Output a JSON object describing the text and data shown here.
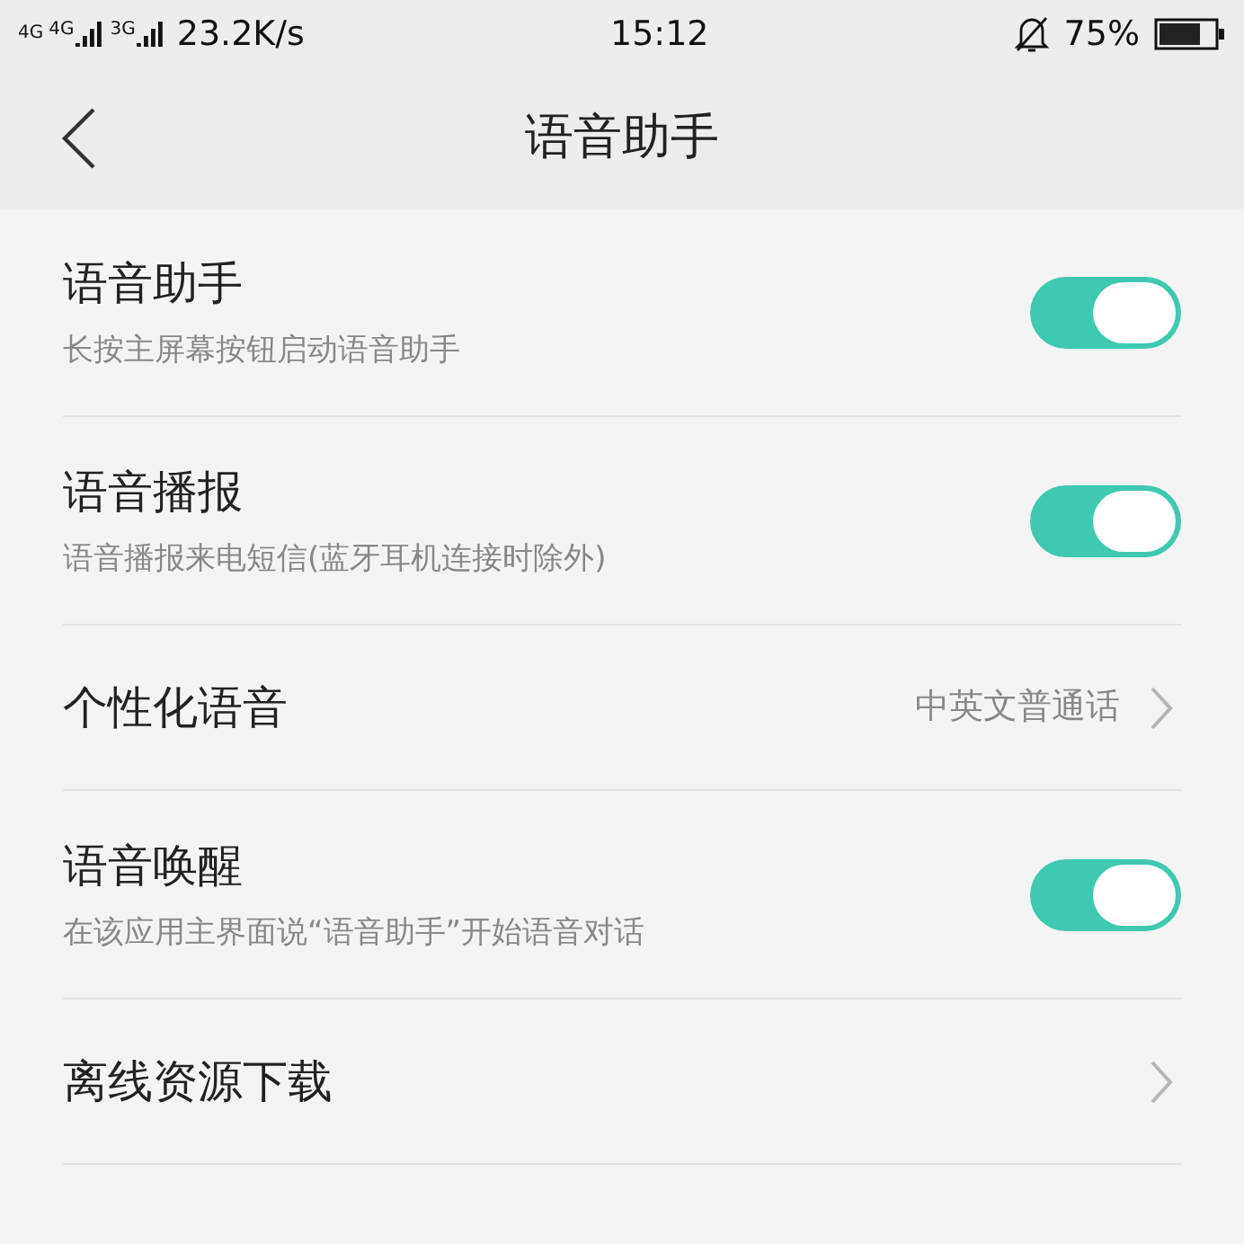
{
  "status_bar": {
    "networks": [
      "4G",
      "4G",
      "3G"
    ],
    "speed": "23.2K/s",
    "time": "15:12",
    "battery": "75%"
  },
  "header": {
    "title": "语音助手"
  },
  "items": [
    {
      "kind": "toggle",
      "title": "语音助手",
      "subtitle": "长按主屏幕按钮启动语音助手",
      "on": true
    },
    {
      "kind": "toggle",
      "title": "语音播报",
      "subtitle": "语音播报来电短信(蓝牙耳机连接时除外)",
      "on": true
    },
    {
      "kind": "link",
      "title": "个性化语音",
      "value": "中英文普通话"
    },
    {
      "kind": "toggle",
      "title": "语音唤醒",
      "subtitle": "在该应用主界面说“语音助手”开始语音对话",
      "on": true
    },
    {
      "kind": "link",
      "title": "离线资源下载"
    }
  ]
}
